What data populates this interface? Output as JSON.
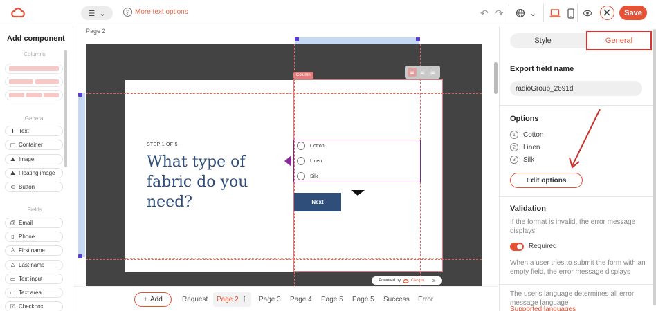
{
  "toolbar": {
    "help_text": "More text options",
    "save_label": "Save"
  },
  "left_panel": {
    "title": "Add component",
    "columns_section": "Columns",
    "general_section": "General",
    "fields_section": "Fields",
    "general_items": [
      {
        "label": "Text",
        "icon": "text-icon"
      },
      {
        "label": "Container",
        "icon": "container-icon"
      },
      {
        "label": "Image",
        "icon": "image-icon"
      },
      {
        "label": "Floating image",
        "icon": "floating-image-icon"
      },
      {
        "label": "Button",
        "icon": "button-icon"
      }
    ],
    "field_items": [
      {
        "label": "Email",
        "icon": "at-icon"
      },
      {
        "label": "Phone",
        "icon": "phone-icon"
      },
      {
        "label": "First name",
        "icon": "person-icon"
      },
      {
        "label": "Last name",
        "icon": "person-icon"
      },
      {
        "label": "Text input",
        "icon": "text-input-icon"
      },
      {
        "label": "Text area",
        "icon": "text-area-icon"
      },
      {
        "label": "Checkbox",
        "icon": "checkbox-icon"
      }
    ]
  },
  "canvas": {
    "page_label": "Page 2",
    "column_tag": "Column",
    "step_text": "STEP 1 OF 5",
    "headline": "What type of fabric do you need?",
    "options": [
      "Cotton",
      "Linen",
      "Silk"
    ],
    "next_label": "Next",
    "powered_by": "Powered by",
    "powered_brand": "Claspo"
  },
  "bottom_bar": {
    "add_label": "Add",
    "tabs": [
      "Request",
      "Page 2",
      "Page 3",
      "Page 4",
      "Page 5",
      "Page 5",
      "Success",
      "Error"
    ],
    "active_tab": "Page 2"
  },
  "right_panel": {
    "tab_style": "Style",
    "tab_general": "General",
    "export_heading": "Export field name",
    "export_value": "radioGroup_2691d",
    "options_heading": "Options",
    "options": [
      "Cotton",
      "Linen",
      "Silk"
    ],
    "edit_options_label": "Edit options",
    "validation_heading": "Validation",
    "validation_desc": "If the format is invalid, the error message displays",
    "required_label": "Required",
    "required_on": true,
    "required_desc": "When a user tries to submit the form with an empty field, the error message displays",
    "language_desc": "The user's language determines all error message language",
    "supported_link": "Supported languages"
  },
  "colors": {
    "accent": "#e55235",
    "heading_blue": "#2f4e7a",
    "selection_purple": "#7a2a8a",
    "annotation_red": "#d9332f"
  }
}
